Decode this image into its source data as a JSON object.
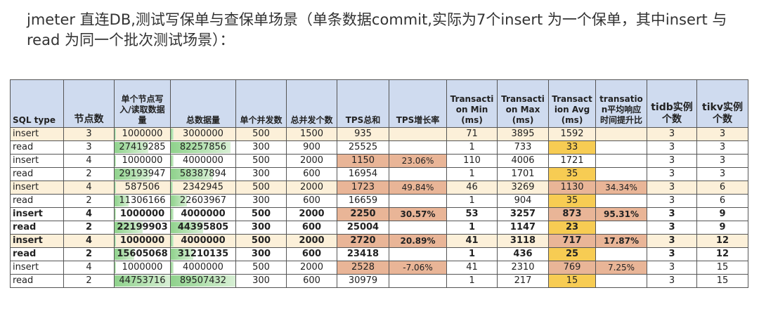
{
  "title": "jmeter 直连DB,测试写保单与查保单场景（单条数据commit,实际为7个insert 为一个保单，其中insert 与read 为同一个批次测试场景）：",
  "headers": {
    "sql_type": "SQL type",
    "nodes": "节点数",
    "per_node": "单个节点写入/读取数据量",
    "total_data": "总数据量",
    "concurrency": "单个并发数",
    "total_concurrency": "总并发个数",
    "tps_total": "TPS总和",
    "tps_growth": "TPS增长率",
    "t_min": "Transaction Min (ms)",
    "t_max": "Transaction Max (ms)",
    "t_avg": "Transaction Avg (ms)",
    "avg_improve": "transation平均响应时间提升比",
    "tidb": "tidb实例个数",
    "tikv": "tikv实例个数"
  },
  "rows": [
    {
      "type": "insert",
      "nodes": "3",
      "per": "1000000",
      "per_fill": 0.02,
      "total": "3000000",
      "total_fill": 0.04,
      "conc": "500",
      "tconc": "1500",
      "tps": "935",
      "growth": "",
      "min": "71",
      "max": "3895",
      "avg": "1592",
      "imp": "",
      "tidb": "3",
      "tikv": "3"
    },
    {
      "type": "read",
      "nodes": "3",
      "per": "27419285",
      "per_fill": 0.61,
      "total": "82257856",
      "total_fill": 0.92,
      "conc": "300",
      "tconc": "900",
      "tps": "25525",
      "growth": "",
      "min": "1",
      "max": "733",
      "avg": "33",
      "imp": "",
      "tidb": "3",
      "tikv": "3"
    },
    {
      "type": "insert",
      "nodes": "4",
      "per": "1000000",
      "per_fill": 0.02,
      "total": "4000000",
      "total_fill": 0.04,
      "conc": "500",
      "tconc": "2000",
      "tps": "1150",
      "growth": "23.06%",
      "min": "110",
      "max": "4006",
      "avg": "1721",
      "imp": "",
      "tidb": "3",
      "tikv": "3"
    },
    {
      "type": "read",
      "nodes": "2",
      "per": "29193947",
      "per_fill": 0.65,
      "total": "58387894",
      "total_fill": 0.65,
      "conc": "300",
      "tconc": "600",
      "tps": "16954",
      "growth": "",
      "min": "1",
      "max": "1701",
      "avg": "35",
      "imp": "",
      "tidb": "3",
      "tikv": "3"
    },
    {
      "type": "insert",
      "nodes": "4",
      "per": "587506",
      "per_fill": 0.01,
      "total": "2342945",
      "total_fill": 0.03,
      "conc": "500",
      "tconc": "2000",
      "tps": "1723",
      "growth": "49.84%",
      "min": "46",
      "max": "3269",
      "avg": "1130",
      "imp": "34.34%",
      "tidb": "3",
      "tikv": "6"
    },
    {
      "type": "read",
      "nodes": "2",
      "per": "11306166",
      "per_fill": 0.25,
      "total": "22603967",
      "total_fill": 0.25,
      "conc": "300",
      "tconc": "600",
      "tps": "16659",
      "growth": "",
      "min": "1",
      "max": "904",
      "avg": "35",
      "imp": "",
      "tidb": "3",
      "tikv": "6"
    },
    {
      "type": "insert",
      "nodes": "4",
      "per": "1000000",
      "per_fill": 0.02,
      "total": "4000000",
      "total_fill": 0.04,
      "conc": "500",
      "tconc": "2000",
      "tps": "2250",
      "growth": "30.57%",
      "min": "53",
      "max": "3257",
      "avg": "873",
      "imp": "95.31%",
      "tidb": "3",
      "tikv": "9"
    },
    {
      "type": "read",
      "nodes": "2",
      "per": "22199903",
      "per_fill": 0.5,
      "total": "44395805",
      "total_fill": 0.5,
      "conc": "300",
      "tconc": "600",
      "tps": "25004",
      "growth": "",
      "min": "1",
      "max": "1147",
      "avg": "23",
      "imp": "",
      "tidb": "3",
      "tikv": "9"
    },
    {
      "type": "insert",
      "nodes": "4",
      "per": "1000000",
      "per_fill": 0.02,
      "total": "4000000",
      "total_fill": 0.04,
      "conc": "500",
      "tconc": "2000",
      "tps": "2720",
      "growth": "20.89%",
      "min": "41",
      "max": "3118",
      "avg": "717",
      "imp": "17.87%",
      "tidb": "3",
      "tikv": "12"
    },
    {
      "type": "read",
      "nodes": "2",
      "per": "15605068",
      "per_fill": 0.35,
      "total": "31210135",
      "total_fill": 0.35,
      "conc": "300",
      "tconc": "600",
      "tps": "23418",
      "growth": "",
      "min": "1",
      "max": "436",
      "avg": "25",
      "imp": "",
      "tidb": "3",
      "tikv": "12"
    },
    {
      "type": "insert",
      "nodes": "4",
      "per": "1000000",
      "per_fill": 0.02,
      "total": "4000000",
      "total_fill": 0.04,
      "conc": "500",
      "tconc": "2000",
      "tps": "2528",
      "growth": "-7.06%",
      "min": "41",
      "max": "2310",
      "avg": "769",
      "imp": "7.25%",
      "tidb": "3",
      "tikv": "15"
    },
    {
      "type": "read",
      "nodes": "2",
      "per": "44753716",
      "per_fill": 1.0,
      "total": "89507432",
      "total_fill": 1.0,
      "conc": "300",
      "tconc": "600",
      "tps": "30979",
      "growth": "",
      "min": "1",
      "max": "217",
      "avg": "15",
      "imp": "",
      "tidb": "3",
      "tikv": "15"
    }
  ],
  "colors": {
    "header": "#cfdbef",
    "row_highlight": "#fcf0d9",
    "orange": "#e9b597",
    "yellow": "#f7cc53",
    "bar": "#8fd28c"
  }
}
